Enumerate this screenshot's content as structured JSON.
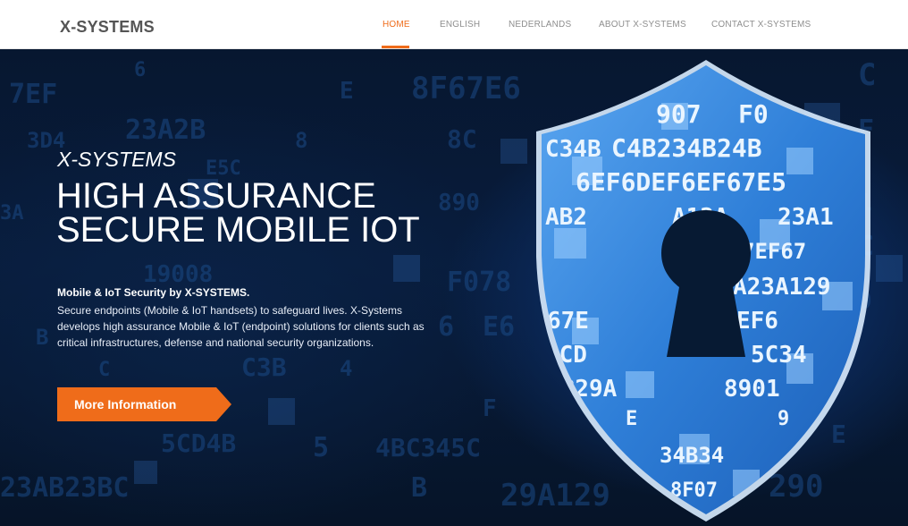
{
  "brand": "X-SYSTEMS",
  "nav": {
    "items": [
      {
        "label": "HOME"
      },
      {
        "label": "ENGLISH"
      },
      {
        "label": "NEDERLANDS"
      },
      {
        "label": "ABOUT X-SYSTEMS"
      },
      {
        "label": "CONTACT X-SYSTEMS"
      }
    ],
    "active": "HOME"
  },
  "hero": {
    "tagline": "X-SYSTEMS",
    "headline_line1": "HIGH ASSURANCE",
    "headline_line2": "SECURE MOBILE IOT",
    "subheading": "Mobile & IoT Security by X-SYSTEMS.",
    "description": "Secure endpoints (Mobile & IoT handsets) to safeguard lives. X-Systems develops high assurance Mobile & IoT (endpoint) solutions for clients such as critical infrastructures, defense and national security organizations.",
    "cta_label": "More Information"
  },
  "colors": {
    "accent": "#ef6c1a",
    "hero_bg": "#061428",
    "shield": "#3a8be3"
  },
  "icons": [
    "shield-lock-icon"
  ]
}
